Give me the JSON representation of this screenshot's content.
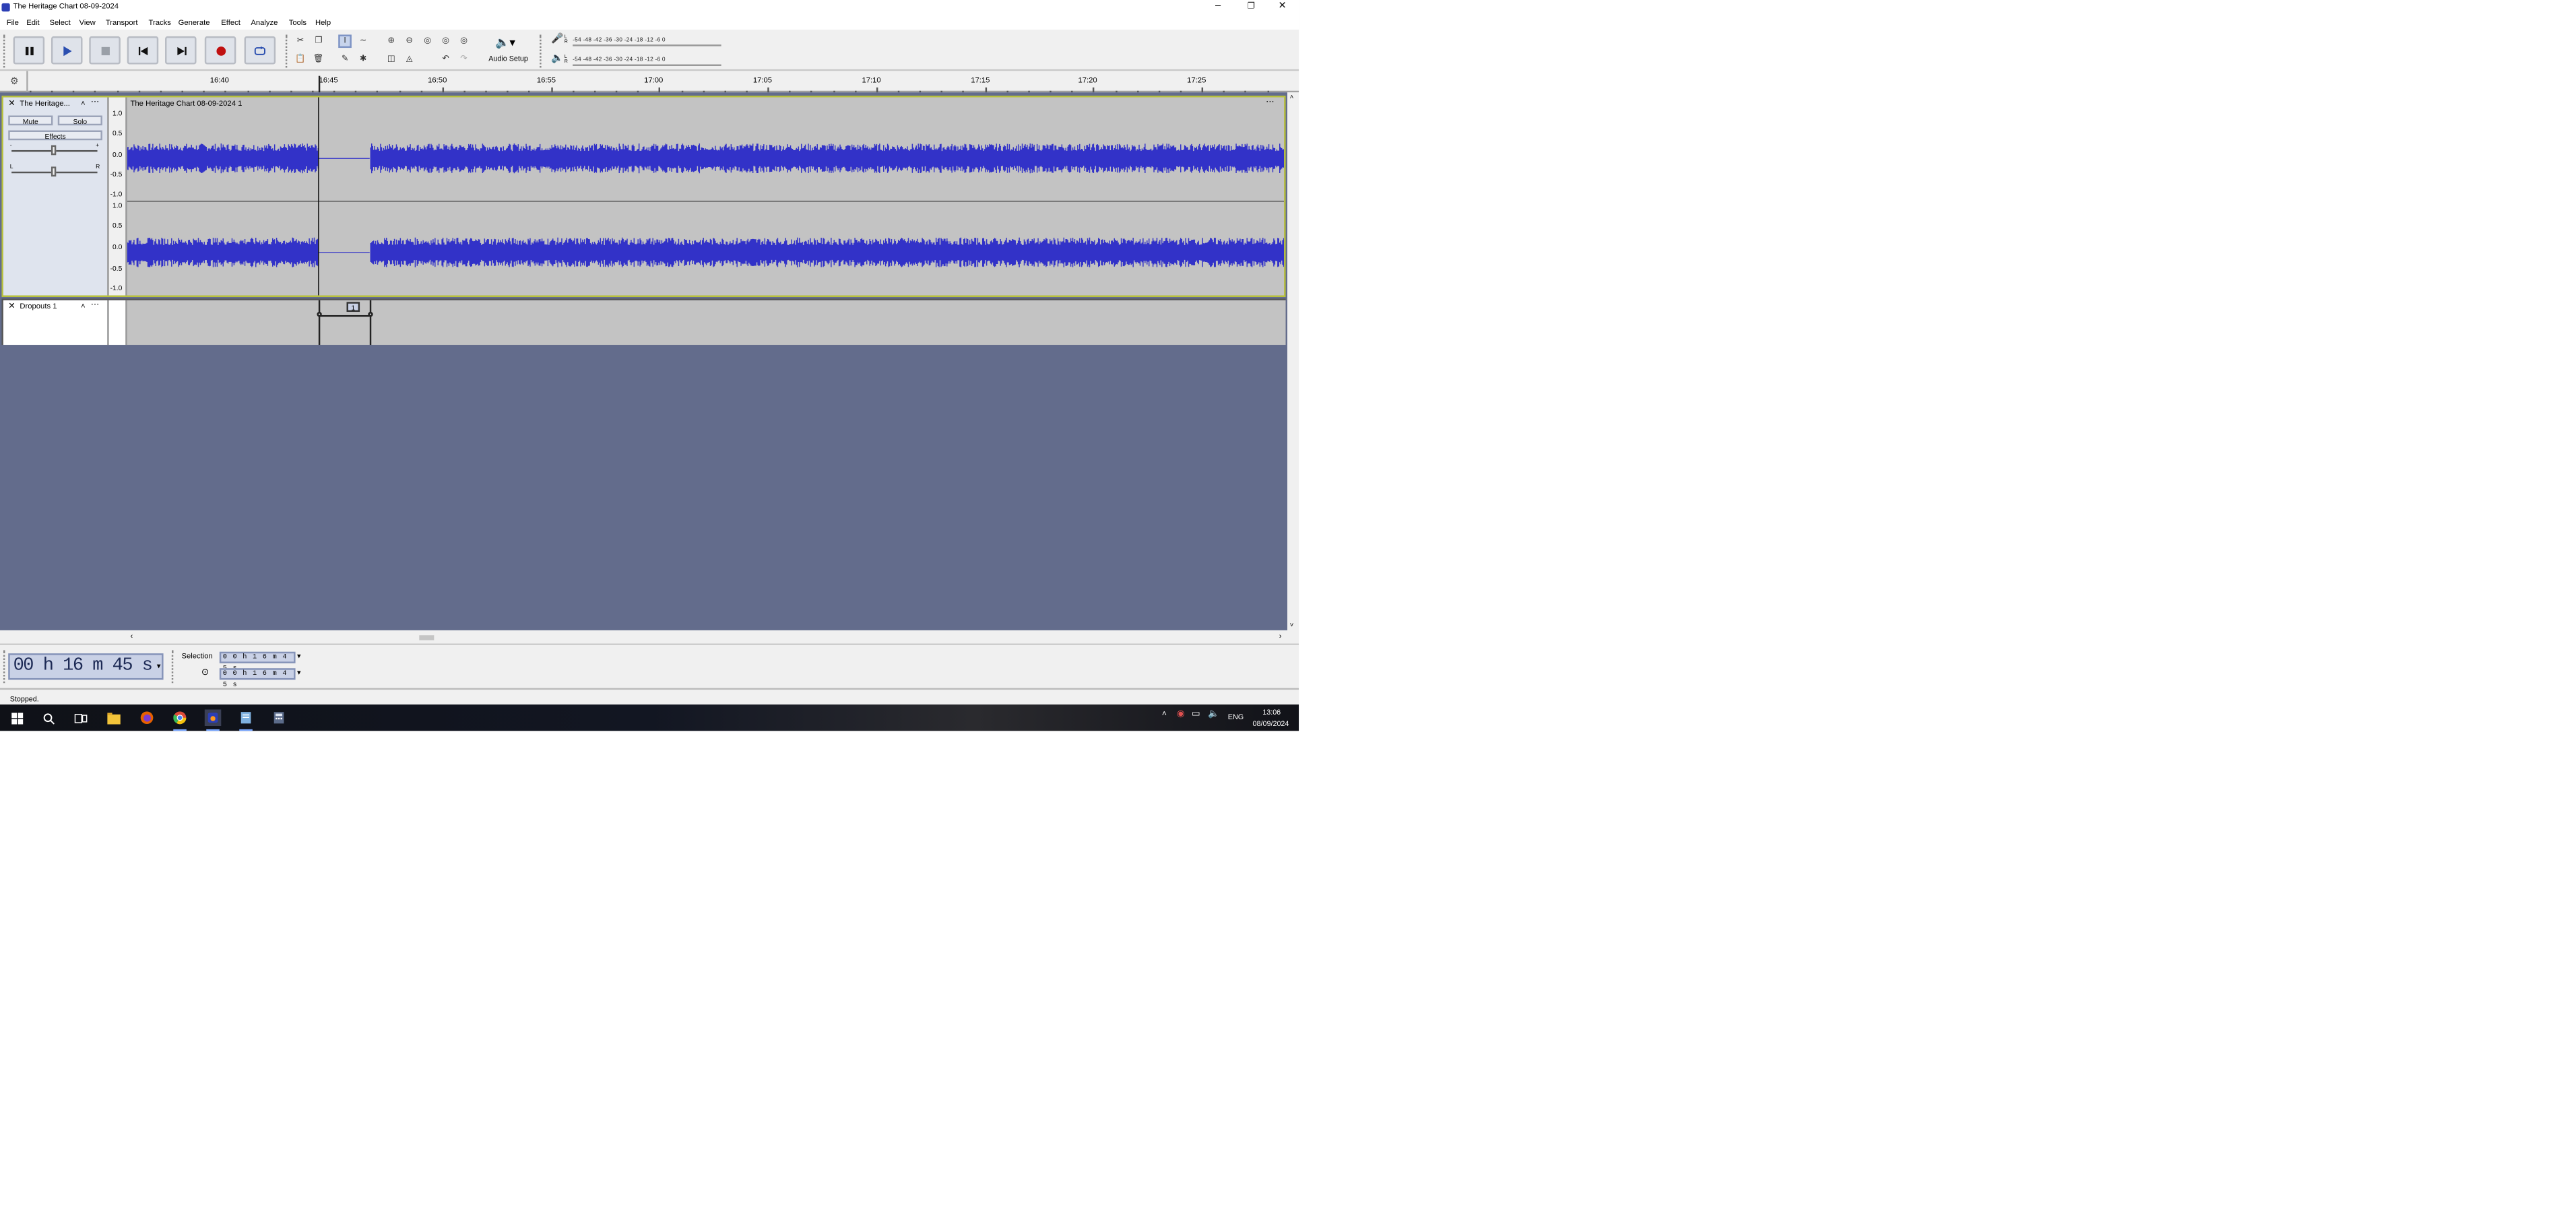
{
  "window": {
    "title": "The Heritage Chart 08-09-2024"
  },
  "menu": [
    "File",
    "Edit",
    "Select",
    "View",
    "Transport",
    "Tracks",
    "Generate",
    "Effect",
    "Analyze",
    "Tools",
    "Help"
  ],
  "toolbar": {
    "audio_setup_label": "Audio Setup",
    "meter_scale": "-54 -48 -42 -36 -30 -24 -18 -12 -6 0",
    "record_meter_channels": "L R",
    "playback_meter_channels": "L R"
  },
  "timeline": {
    "labels": [
      "16:40",
      "16:45",
      "16:50",
      "16:55",
      "17:00",
      "17:05",
      "17:10",
      "17:15",
      "17:20",
      "17:25"
    ]
  },
  "audio_track": {
    "name": "The Heritage...",
    "clip_name": "The Heritage Chart 08-09-2024 1",
    "mute_label": "Mute",
    "solo_label": "Solo",
    "effects_label": "Effects",
    "gain_min": "-",
    "gain_max": "+",
    "pan_left": "L",
    "pan_right": "R",
    "ruler_labels": [
      "1.0",
      "0.5",
      "0.0",
      "-0.5",
      "-1.0"
    ]
  },
  "label_track": {
    "name": "Dropouts 1",
    "label_text": "1"
  },
  "time_display": {
    "value": "00 h 16 m 45 s"
  },
  "selection": {
    "label": "Selection",
    "start": "0 0 h 1 6 m 4 5 s",
    "end": "0 0 h 1 6 m 4 5 s"
  },
  "status": {
    "text": "Stopped."
  },
  "taskbar": {
    "language": "ENG",
    "time": "13:06",
    "date": "08/09/2024"
  },
  "colors": {
    "waveform": "#3232c8",
    "clip_background": "#c3c3c3",
    "track_area": "#636c8c",
    "record_red": "#c01010",
    "play_blue": "#2b4fb0"
  }
}
